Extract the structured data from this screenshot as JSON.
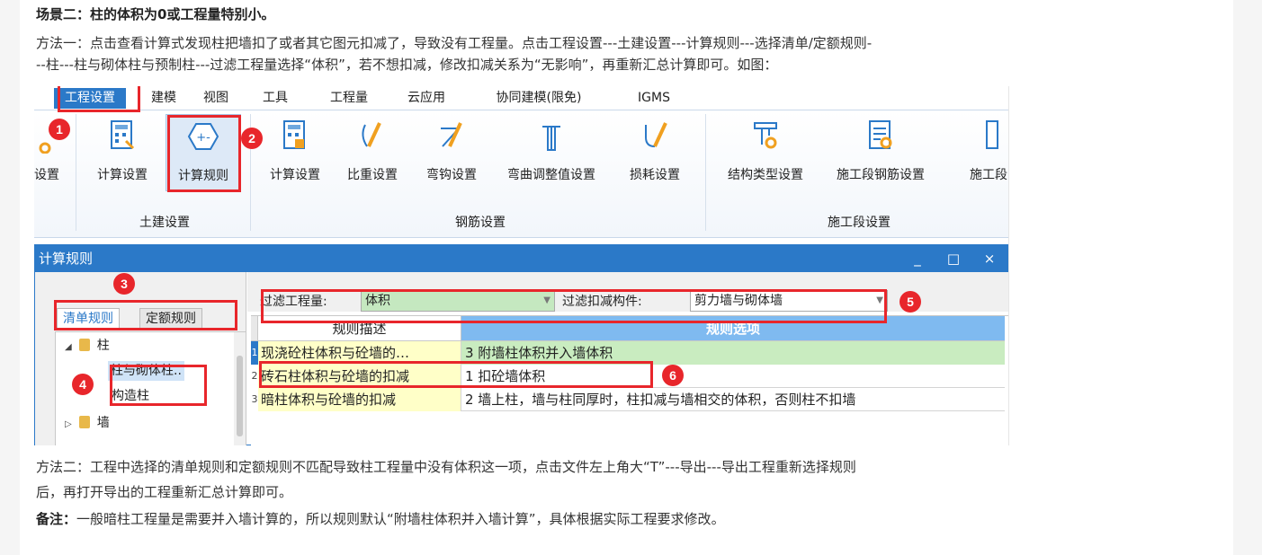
{
  "article": {
    "scene_title": "场景二：柱的体积为0或工程量特别小。",
    "method1_line1": "方法一：点击查看计算式发现柱把墙扣了或者其它图元扣减了，导致没有工程量。点击工程设置---土建设置---计算规则---选择清单/定额规则-",
    "method1_line2": "--柱---柱与砌体柱与预制柱---过滤工程量选择“体积”，若不想扣减，修改扣减关系为“无影响”，再重新汇总计算即可。如图：",
    "method2_line1": "方法二：工程中选择的清单规则和定额规则不匹配导致柱工程量中没有体积这一项，点击文件左上角大“T”---导出---导出工程重新选择规则",
    "method2_line2": "后，再打开导出的工程重新汇总计算即可。",
    "note_label": "备注：",
    "note_text": "一般暗柱工程量是需要并入墙计算的，所以规则默认“附墙柱体积并入墙计算”，具体根据实际工程要求修改。"
  },
  "menu_tabs": [
    "工程设置",
    "建模",
    "视图",
    "工具",
    "工程量",
    "云应用",
    "协同建模(限免)",
    "IGMS"
  ],
  "ribbon": {
    "buttons": [
      "设置",
      "计算设置",
      "计算规则",
      "计算设置",
      "比重设置",
      "弯钩设置",
      "弯曲调整值设置",
      "损耗设置",
      "结构类型设置",
      "施工段钢筋设置",
      "施工段"
    ],
    "groups": [
      "土建设置",
      "钢筋设置",
      "施工段设置"
    ]
  },
  "dialog": {
    "title": "计算规则",
    "window_buttons": [
      "_",
      "□",
      "×"
    ],
    "rule_tabs": [
      "清单规则",
      "定额规则"
    ],
    "tree": [
      "柱",
      "柱与砌体柱..",
      "构造柱",
      "墙"
    ],
    "filter_quantity_label": "过滤工程量:",
    "filter_quantity_value": "体积",
    "filter_deduct_label": "过滤扣减构件:",
    "filter_deduct_value": "剪力墙与砌体墙",
    "grid_headers": [
      "规则描述",
      "规则选项"
    ],
    "rows": [
      {
        "num": "1",
        "desc": "现浇砼柱体积与砼墙的…",
        "option": "3 附墙柱体积并入墙体积"
      },
      {
        "num": "2",
        "desc": "砖石柱体积与砼墙的扣减",
        "option": "1 扣砼墙体积"
      },
      {
        "num": "3",
        "desc": "暗柱体积与砼墙的扣减",
        "option": "2 墙上柱，墙与柱同厚时，柱扣减与墙相交的体积，否则柱不扣墙"
      }
    ]
  },
  "callouts": [
    "1",
    "2",
    "3",
    "4",
    "5",
    "6"
  ],
  "colors": {
    "accent": "#2b79c8",
    "callout": "#e8262b",
    "highlight_green": "#c9ecc0",
    "desc_yellow": "#ffffc8"
  }
}
